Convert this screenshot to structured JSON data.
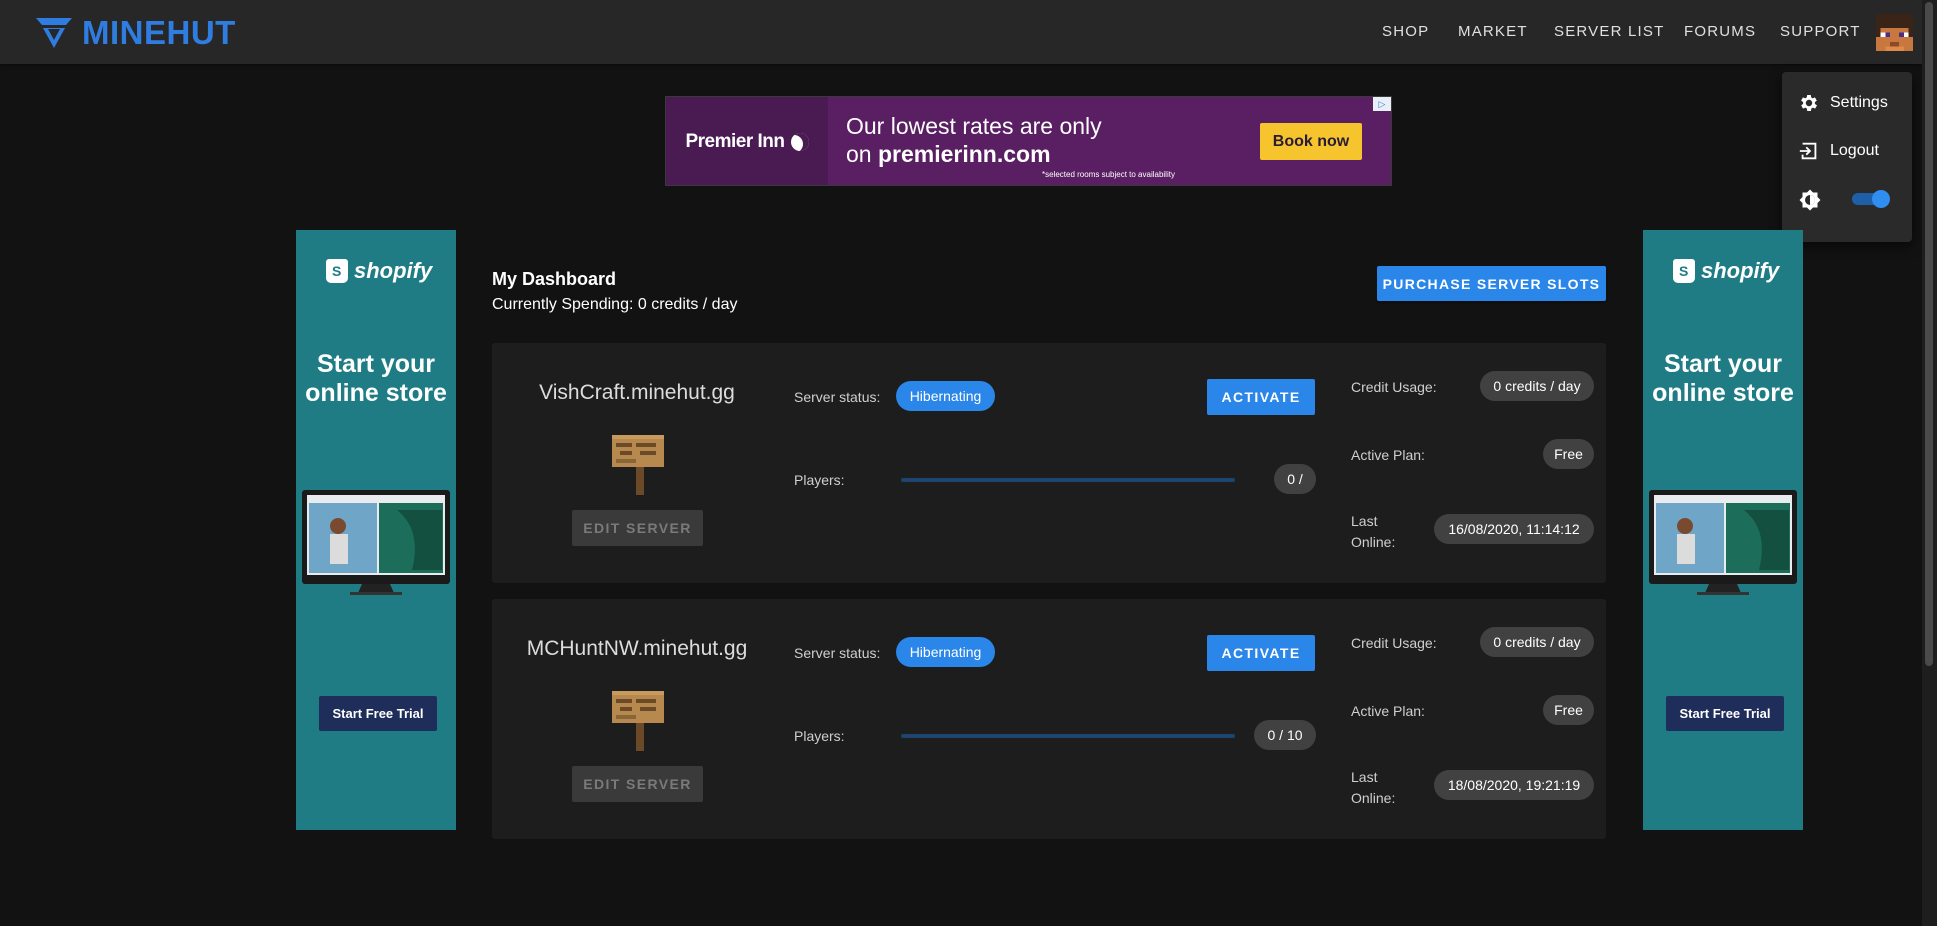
{
  "header": {
    "brand": "MINEHUT",
    "nav": [
      {
        "label": "SHOP"
      },
      {
        "label": "MARKET"
      },
      {
        "label": "SERVER LIST"
      },
      {
        "label": "FORUMS"
      },
      {
        "label": "SUPPORT"
      }
    ]
  },
  "dropdown": {
    "settings_label": "Settings",
    "logout_label": "Logout",
    "dark_mode_on": true
  },
  "top_ad": {
    "brand": "Premier Inn",
    "headline_line1": "Our lowest rates are only",
    "headline_line2_prefix": "on ",
    "headline_line2_domain": "premierinn.com",
    "fine_print": "*selected rooms subject to availability",
    "cta": "Book now"
  },
  "side_ads": {
    "brand": "shopify",
    "pitch_line1": "Start your",
    "pitch_line2": "online store",
    "cta": "Start Free Trial"
  },
  "dashboard": {
    "title": "My Dashboard",
    "spending": "Currently Spending: 0 credits / day",
    "purchase_label": "PURCHASE SERVER SLOTS"
  },
  "labels": {
    "server_status": "Server status:",
    "players": "Players:",
    "credit_usage": "Credit Usage:",
    "active_plan": "Active Plan:",
    "last": "Last",
    "online": "Online:",
    "edit": "EDIT SERVER",
    "activate": "ACTIVATE"
  },
  "servers": [
    {
      "name": "VishCraft.minehut.gg",
      "status": "Hibernating",
      "players_text": "0 /",
      "players_fraction": 0,
      "credit_usage": "0 credits / day",
      "plan": "Free",
      "last_online": "16/08/2020, 11:14:12"
    },
    {
      "name": "MCHuntNW.minehut.gg",
      "status": "Hibernating",
      "players_text": "0 / 10",
      "players_fraction": 0,
      "credit_usage": "0 credits / day",
      "plan": "Free",
      "last_online": "18/08/2020, 19:21:19"
    }
  ],
  "colors": {
    "accent": "#2a86e8",
    "brand": "#2f7de1",
    "background": "#121212",
    "card": "#1d1d1d"
  }
}
